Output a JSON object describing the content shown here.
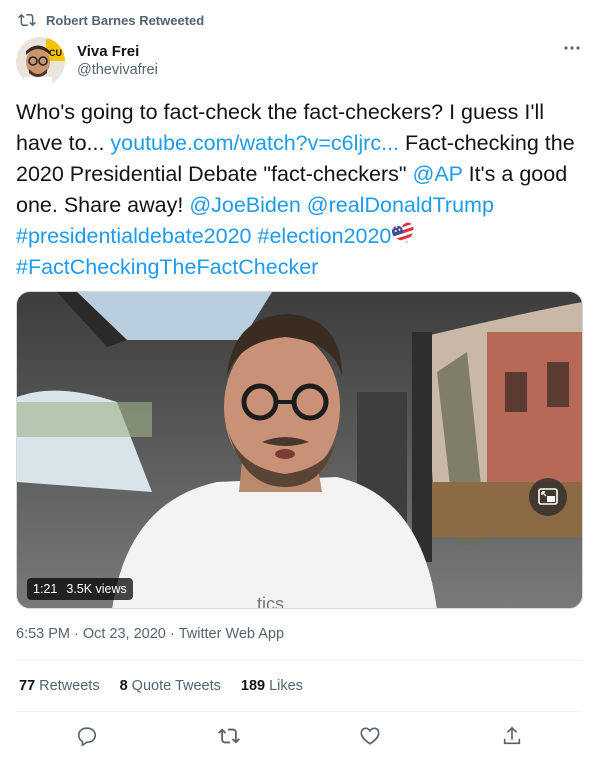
{
  "retweet_banner": {
    "label": "Robert Barnes Retweeted",
    "icon": "retweet-icon"
  },
  "author": {
    "display_name": "Viva Frei",
    "handle": "@thevivafrei",
    "avatar_badge": "CU"
  },
  "tweet": {
    "segments": [
      {
        "text": "Who's going to fact-check the fact-checkers? I guess I'll have to... ",
        "type": "text"
      },
      {
        "text": "youtube.com/watch?v=c6ljrc...",
        "type": "link"
      },
      {
        "text": " Fact-checking the 2020 Presidential Debate \"fact-checkers\" ",
        "type": "text"
      },
      {
        "text": "@AP",
        "type": "link"
      },
      {
        "text": " It's a good one. Share away! ",
        "type": "text"
      },
      {
        "text": "@JoeBiden",
        "type": "link"
      },
      {
        "text": " ",
        "type": "text"
      },
      {
        "text": "@realDonaldTrump",
        "type": "link"
      },
      {
        "text": " ",
        "type": "text"
      },
      {
        "text": "#presidentialdebate2020",
        "type": "link"
      },
      {
        "text": " ",
        "type": "text"
      },
      {
        "text": "#election2020",
        "type": "link"
      }
    ],
    "emoji": "us-flag-heart-emoji",
    "last_line": "#FactCheckingTheFactChecker"
  },
  "video": {
    "duration": "1:21",
    "views": "3.5K views",
    "shirt_text": "...tics"
  },
  "meta": {
    "time": "6:53 PM",
    "separator": "·",
    "date": "Oct 23, 2020",
    "source": "Twitter Web App"
  },
  "stats": [
    {
      "count": "77",
      "label": "Retweets"
    },
    {
      "count": "8",
      "label": "Quote Tweets"
    },
    {
      "count": "189",
      "label": "Likes"
    }
  ],
  "colors": {
    "link": "#1d9bf0",
    "secondary": "#536471",
    "text": "#0f1419",
    "divider": "#eff3f4"
  }
}
